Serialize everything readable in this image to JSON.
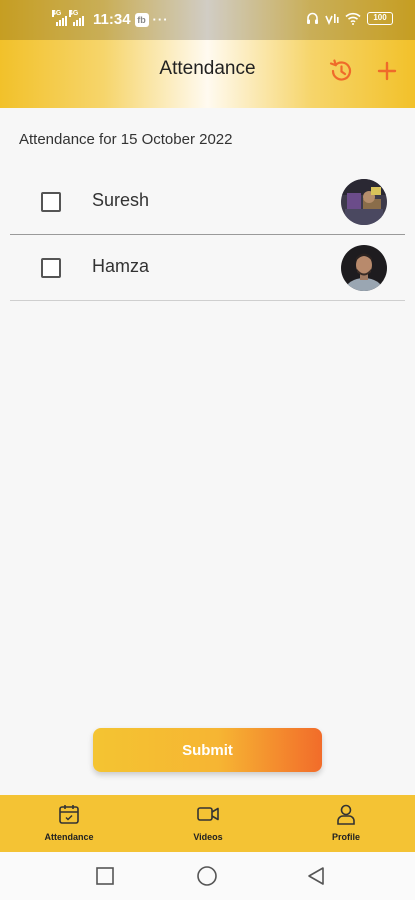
{
  "status_bar": {
    "network_1": "4G",
    "network_2": "4G",
    "time": "11:34",
    "app_badge": "fb",
    "more": "···",
    "battery": "100"
  },
  "header": {
    "title": "Attendance",
    "history_icon": "history-icon",
    "add_icon": "plus-icon"
  },
  "attendance": {
    "date_label": "Attendance for 15 October 2022",
    "students": [
      {
        "name": "Suresh",
        "checked": false
      },
      {
        "name": "Hamza",
        "checked": false
      }
    ]
  },
  "submit_label": "Submit",
  "bottom_nav": {
    "items": [
      {
        "label": "Attendance",
        "icon": "calendar-icon"
      },
      {
        "label": "Videos",
        "icon": "video-icon"
      },
      {
        "label": "Profile",
        "icon": "person-icon"
      }
    ]
  },
  "system_nav": {
    "recents": "square-icon",
    "home": "circle-icon",
    "back": "triangle-back-icon"
  },
  "colors": {
    "accent": "#f4c334",
    "icon_orange": "#ef6a2a"
  }
}
